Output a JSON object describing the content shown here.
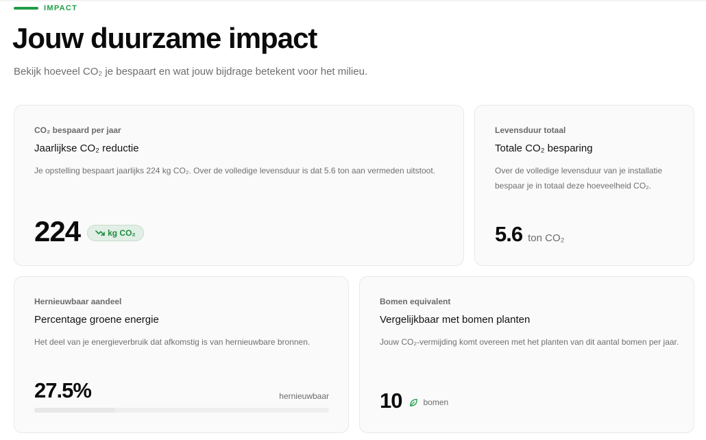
{
  "header": {
    "eyebrow": "IMPACT",
    "title": "Jouw duurzame impact",
    "subtitle": "Bekijk hoeveel CO₂ je bespaart en wat jouw bijdrage betekent voor het milieu."
  },
  "cards": [
    {
      "label": "CO₂ bespaard per jaar",
      "title": "Jaarlijkse CO₂ reductie",
      "description": "Je opstelling bespaart jaarlijks 224 kg CO₂. Over de volledige levensduur is dat 5.6 ton aan vermeden uitstoot.",
      "value": "224",
      "unit": "kg CO₂",
      "badge_icon": "trend-down-icon"
    },
    {
      "label": "Levensduur totaal",
      "title": "Totale CO₂ besparing",
      "description": "Over de volledige levensduur van je installatie bespaar je in totaal deze hoeveelheid CO₂.",
      "value": "5.6",
      "unit": "ton CO₂"
    },
    {
      "label": "Hernieuwbaar aandeel",
      "title": "Percentage groene energie",
      "description": "Het deel van je energieverbruik dat afkomstig is van hernieuwbare bronnen.",
      "value": "27.5%",
      "unit": "hernieuwbaar",
      "progress_percent": 27.5
    },
    {
      "label": "Bomen equivalent",
      "title": "Vergelijkbaar met bomen planten",
      "description": "Jouw CO₂-vermijding komt overeen met het planten van dit aantal bomen per jaar.",
      "value": "10",
      "unit": "bomen",
      "unit_icon": "leaf-icon"
    }
  ],
  "colors": {
    "accent": "#1f9d47",
    "badge_bg": "#e2efe6",
    "card_bg": "#fafafa",
    "card_border": "#e9e9e9"
  }
}
